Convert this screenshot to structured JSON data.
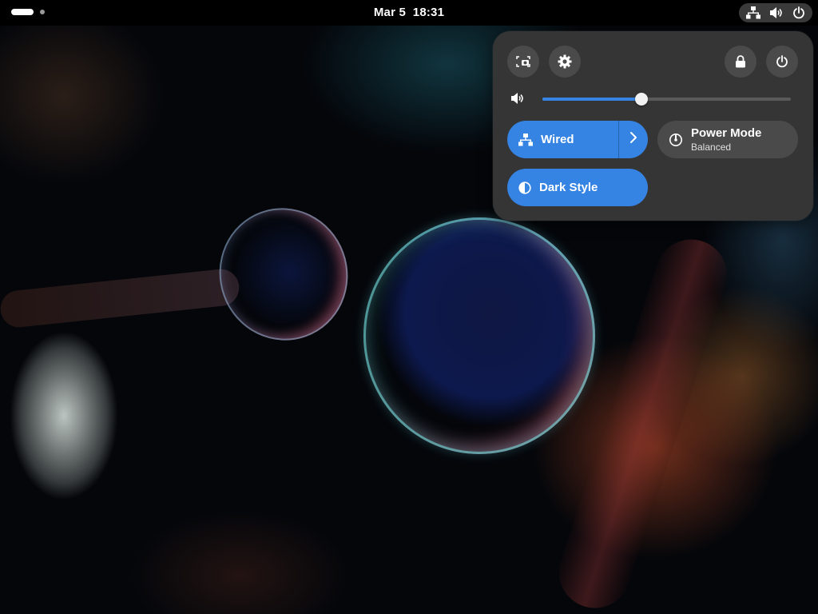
{
  "topbar": {
    "activities_icon": "activities-pill-icon",
    "workspace_dot_icon": "workspace-dot-icon",
    "clock_date": "Mar 5",
    "clock_time": "18:31",
    "status_icons": [
      "network-wired-icon",
      "volume-icon",
      "power-icon"
    ]
  },
  "quick_settings": {
    "top_buttons": [
      {
        "name": "screenshot",
        "icon": "screenshot-icon"
      },
      {
        "name": "settings",
        "icon": "gear-icon"
      },
      {
        "name": "lock",
        "icon": "lock-icon"
      },
      {
        "name": "power",
        "icon": "power-icon"
      }
    ],
    "volume": {
      "icon": "volume-icon",
      "level_fraction": 0.4
    },
    "tiles": {
      "wired": {
        "label": "Wired",
        "icon": "network-wired-icon",
        "active": true,
        "arrow_icon": "chevron-right-icon"
      },
      "power_mode": {
        "label": "Power Mode",
        "subtitle": "Balanced",
        "icon": "power-mode-icon",
        "active": false
      },
      "dark_style": {
        "label": "Dark Style",
        "icon": "dark-style-icon",
        "active": true
      }
    }
  },
  "colors": {
    "accent": "#3584e4",
    "panel_bg": "#353535",
    "button_bg": "#4a4a4a",
    "topbar_bg": "#000000"
  }
}
